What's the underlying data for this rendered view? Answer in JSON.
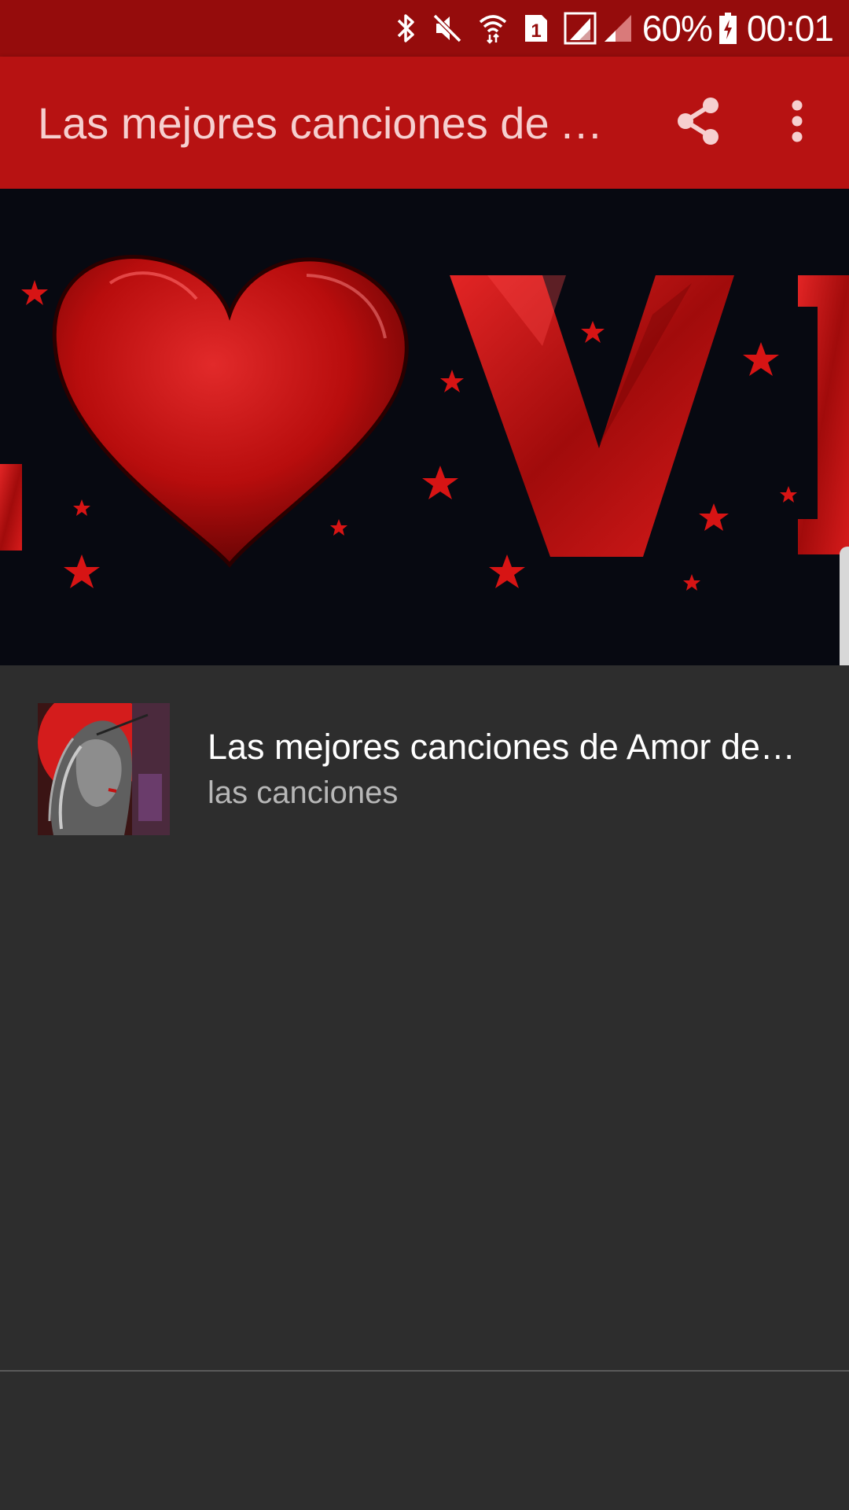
{
  "status_bar": {
    "icons": [
      "bluetooth-icon",
      "mute-icon",
      "wifi-icon",
      "sim-icon",
      "signal-icon",
      "signal-icon"
    ],
    "sim_label": "1",
    "battery_percent": "60%",
    "time": "00:01"
  },
  "app_bar": {
    "title": "Las mejores canciones de Amor de Sam",
    "actions": [
      "share-icon",
      "more-vert-icon"
    ]
  },
  "banner": {
    "text": "LOVE",
    "colors": {
      "background": "#070911",
      "accent": "#d11414"
    }
  },
  "list": {
    "items": [
      {
        "title": "Las mejores canciones de Amor de Sam",
        "subtitle": "las canciones"
      }
    ]
  },
  "colors": {
    "status_bar": "#950c0c",
    "app_bar": "#b71212",
    "body": "#2d2d2d"
  }
}
